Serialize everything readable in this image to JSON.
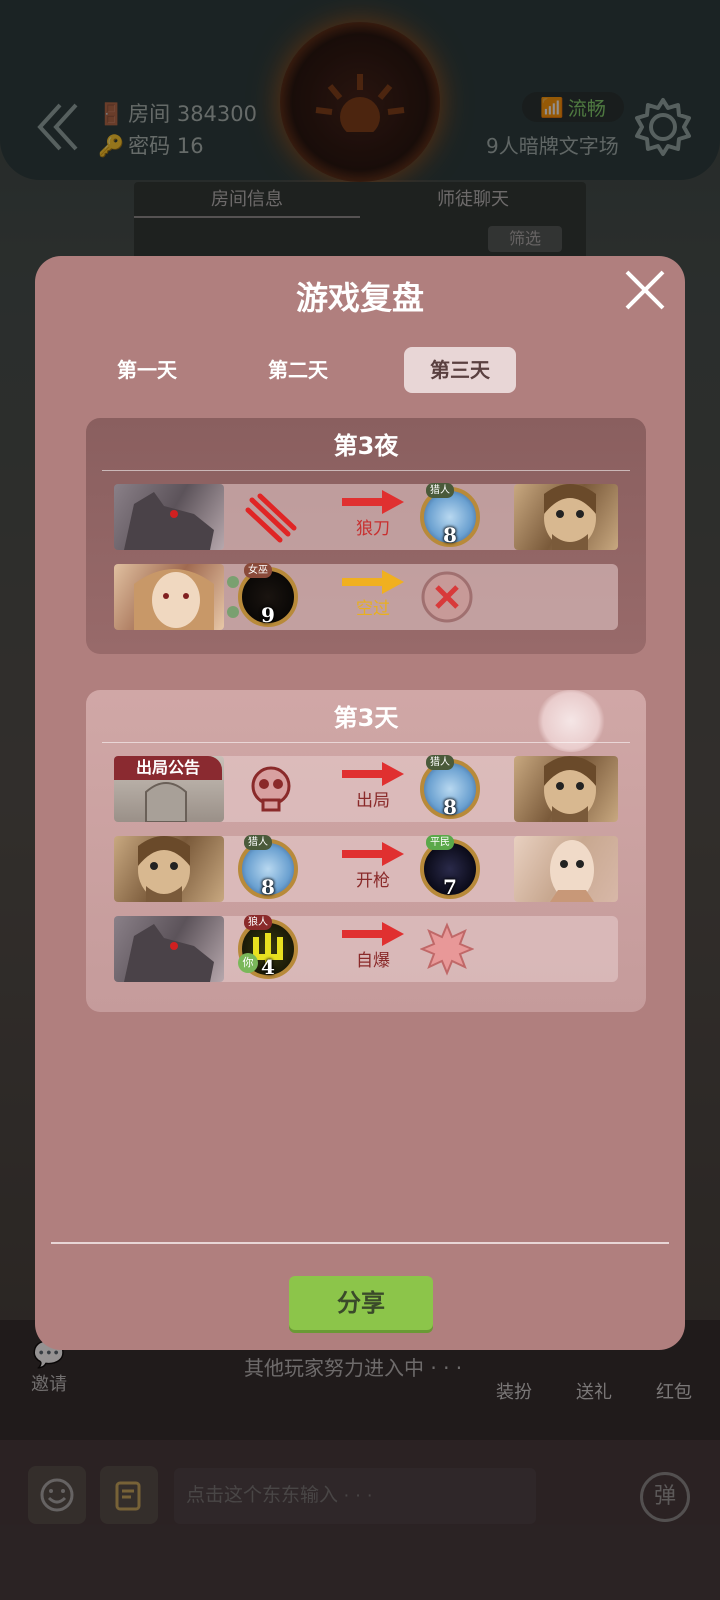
{
  "header": {
    "room_label": "房间 384300",
    "password_label": "密码 16",
    "network_status": "流畅",
    "mode": "9人暗牌文字场"
  },
  "info_panel": {
    "tabs": [
      "房间信息",
      "师徒聊天"
    ],
    "filter_label": "筛选"
  },
  "bottom": {
    "invite_label": "邀请",
    "waiting_text": "其他玩家努力进入中 · · ·",
    "actions": [
      "装扮",
      "送礼",
      "红包"
    ],
    "input_placeholder": "点击这个东东输入 · · ·",
    "danmu_label": "弹"
  },
  "modal": {
    "title": "游戏复盘",
    "day_tabs": [
      "第一天",
      "第二天",
      "第三天"
    ],
    "active_tab": "第三天",
    "share_label": "分享",
    "night_card": {
      "title": "第3夜",
      "events": [
        {
          "actor_role_icon": "werewolf",
          "action_icon": "claw-slash",
          "action_label": "狼刀",
          "target_role": "猎人",
          "target_number": "8"
        },
        {
          "actor_role": "女巫",
          "actor_number": "9",
          "action_label": "空过",
          "result_icon": "cross"
        }
      ]
    },
    "day_card": {
      "title": "第3天",
      "events": [
        {
          "banner": "出局公告",
          "action_icon": "skull",
          "action_label": "出局",
          "target_role": "猎人",
          "target_number": "8"
        },
        {
          "actor_role": "猎人",
          "actor_number": "8",
          "action_label": "开枪",
          "target_role": "平民",
          "target_number": "7"
        },
        {
          "actor_role": "狼人",
          "actor_number": "4",
          "actor_you_tag": "你",
          "action_label": "自爆",
          "result_icon": "explosion"
        }
      ]
    }
  },
  "colors": {
    "modal_bg": "#b07f7e",
    "share_button": "#8cc54a",
    "network_green": "#7ed26b",
    "arrow_red": "#e03030",
    "arrow_yellow": "#f0b020"
  }
}
